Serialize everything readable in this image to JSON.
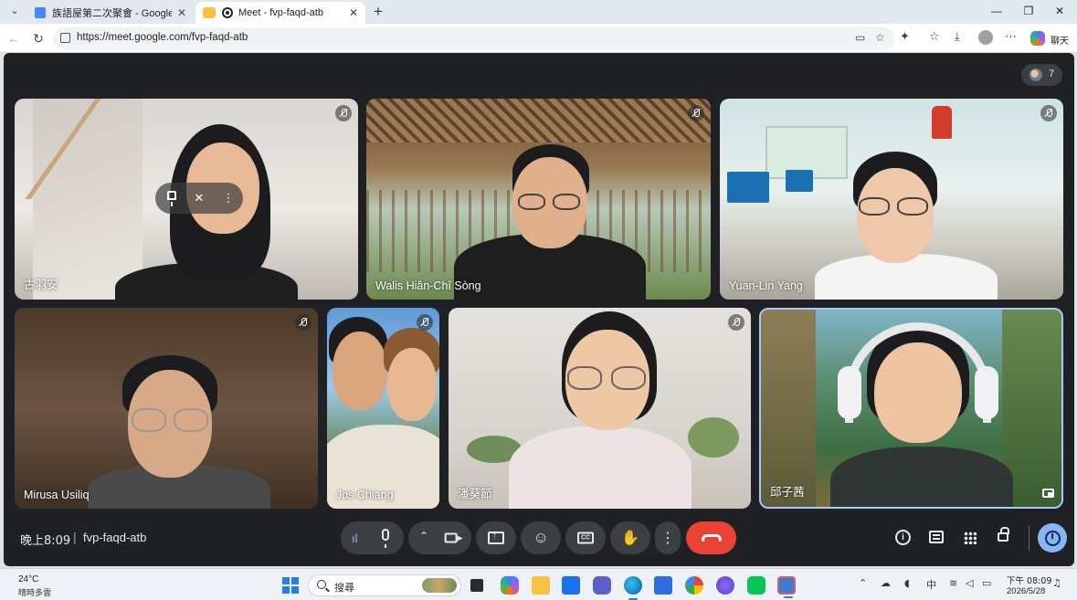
{
  "browser": {
    "tabs": [
      {
        "title": "族語屋第二次聚會 - Google 文件",
        "active": false
      },
      {
        "title": "Meet - fvp-faqd-atb",
        "active": true
      }
    ],
    "url": "https://meet.google.com/fvp-faqd-atb",
    "chat_label": "聊天"
  },
  "meet": {
    "participant_count": "7",
    "participants": [
      {
        "name": "古羽安",
        "muted": true
      },
      {
        "name": "Walis Hiân-Chî Sòng",
        "muted": true
      },
      {
        "name": "Yuan-Lin Yang",
        "muted": true
      },
      {
        "name": "Mirusa Usiliq",
        "muted": true
      },
      {
        "name": "Jos Chiang",
        "muted": true
      },
      {
        "name": "潘葵節",
        "muted": true
      },
      {
        "name": "邱子茜",
        "muted": false
      }
    ],
    "time": "晚上8:09",
    "separator": "|",
    "meeting_code": "fvp-faqd-atb"
  },
  "taskbar": {
    "weather_temp": "24°C",
    "weather_desc": "晴時多雲",
    "search_placeholder": "搜尋",
    "ime": "中",
    "clock_time": "下午 08:09",
    "clock_date": "2026/5/28"
  },
  "colors": {
    "meet_bg": "#202124",
    "control_bg": "#3c4043",
    "hangup": "#ea4335",
    "activities": "#8ab4f8",
    "speaking_border": "#a8c7fa"
  }
}
